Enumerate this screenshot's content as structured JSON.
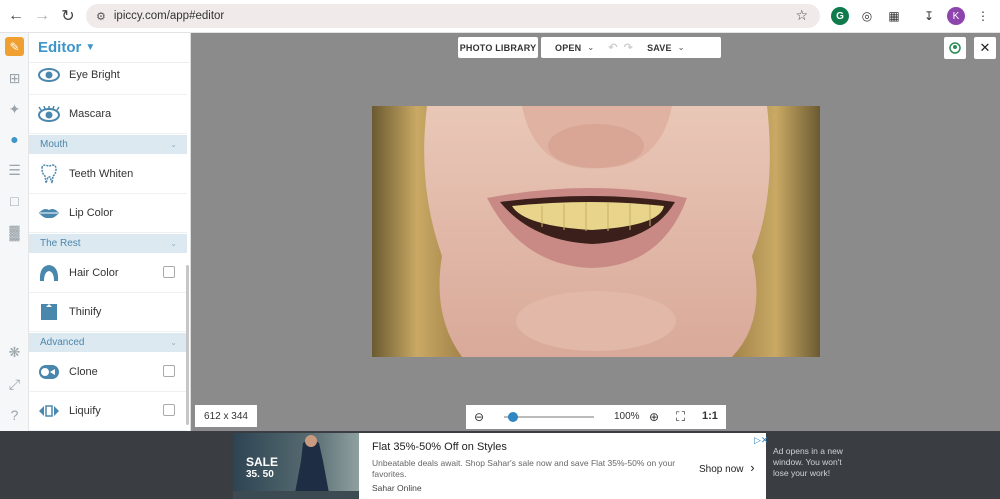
{
  "browser": {
    "url": "ipiccy.com/app#editor",
    "avatar_letter": "K"
  },
  "panel": {
    "title": "Editor",
    "items": [
      {
        "label": "Eye Bright",
        "icon": "eye-bright-icon"
      },
      {
        "label": "Mascara",
        "icon": "mascara-icon"
      },
      {
        "label": "Teeth Whiten",
        "icon": "tooth-icon"
      },
      {
        "label": "Lip Color",
        "icon": "lips-icon"
      },
      {
        "label": "Hair Color",
        "icon": "hair-icon"
      },
      {
        "label": "Thinify",
        "icon": "thinify-icon"
      },
      {
        "label": "Clone",
        "icon": "clone-icon"
      },
      {
        "label": "Liquify",
        "icon": "liquify-icon"
      }
    ],
    "sections": {
      "mouth": "Mouth",
      "rest": "The Rest",
      "advanced": "Advanced"
    }
  },
  "toolbar": {
    "photo_library": "PHOTO LIBRARY",
    "open": "OPEN",
    "save": "SAVE"
  },
  "status": {
    "image_size": "612 x 344",
    "zoom_percent": "100%",
    "zoom_level": 0.1,
    "one_to_one": "1:1"
  },
  "ad": {
    "title": "Flat 35%-50% Off on Styles",
    "body": "Unbeatable deals await. Shop Sahar's sale now and save Flat 35%-50% on your favorites.",
    "source": "Sahar Online",
    "cta": "Shop now",
    "image_sale": "SALE",
    "image_percent": "35. 50",
    "note": "Ad opens in a new window. You won't lose your work!"
  },
  "colors": {
    "accent": "#3d95c9",
    "canvas_bg": "#8b8b8b",
    "section_bg": "#dde9f0"
  }
}
